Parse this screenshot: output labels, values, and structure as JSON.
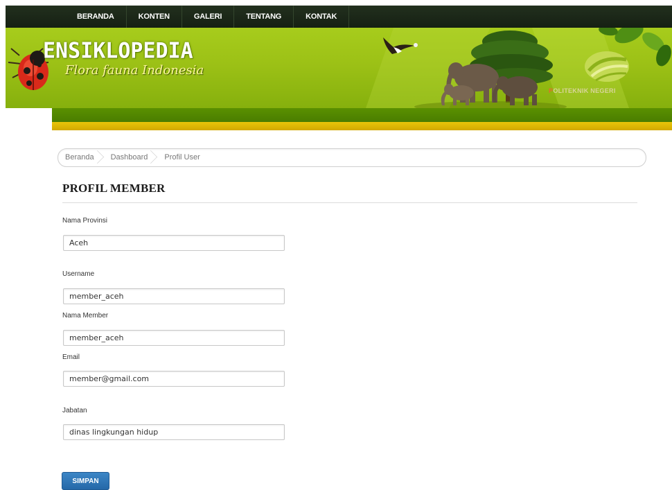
{
  "nav": {
    "items": [
      "BERANDA",
      "KONTEN",
      "GALERI",
      "TENTANG",
      "KONTAK"
    ]
  },
  "header": {
    "title": "ENSIKLOPEDIA",
    "subtitle": "Flora fauna Indonesia",
    "institution_initial": "P",
    "institution_rest": "OLITEKNIK NEGERI"
  },
  "breadcrumb": {
    "items": [
      "Beranda",
      "Dashboard",
      "Profil User"
    ]
  },
  "page": {
    "title": "PROFIL MEMBER"
  },
  "form": {
    "fields": [
      {
        "label": "Nama Provinsi",
        "value": "Aceh"
      },
      {
        "label": "Username",
        "value": "member_aceh"
      },
      {
        "label": "Nama Member",
        "value": "member_aceh"
      },
      {
        "label": "Email",
        "value": "member@gmail.com"
      },
      {
        "label": "Jabatan",
        "value": "dinas lingkungan hidup"
      }
    ],
    "submit_label": "SIMPAN"
  },
  "colors": {
    "nav_bg": "#1b2718",
    "banner_green": "#a3c81a",
    "accent_blue": "#2d74b8",
    "bar_yellow": "#dcb600"
  },
  "icons": {
    "logo": "ladybug-icon",
    "bird": "eagle-icon",
    "institution": "polytechnic-logo-icon"
  }
}
